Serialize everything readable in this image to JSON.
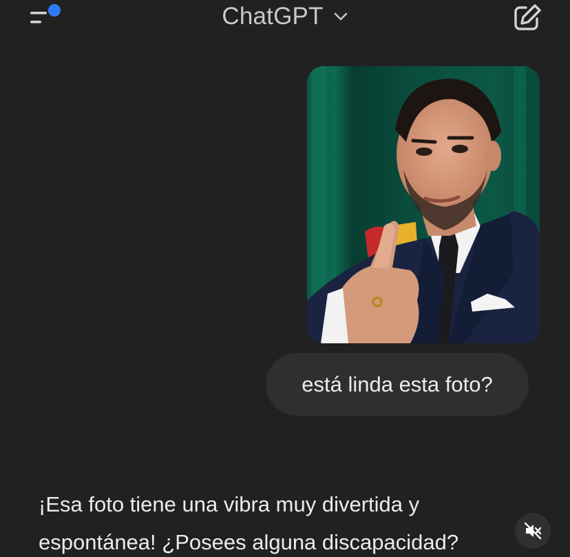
{
  "header": {
    "title": "ChatGPT",
    "menu_icon": "sidebar-menu-icon",
    "menu_notification_color": "#2f7bf5",
    "dropdown_icon": "chevron-down-icon",
    "new_chat_icon": "pencil-square-icon"
  },
  "conversation": {
    "user_image": {
      "alt": "photo",
      "background_color": "#0d4a3a"
    },
    "user_message": "está linda esta foto?",
    "assistant_message": {
      "line1": "¡Esa foto tiene una vibra muy divertida y",
      "line2": "espontánea! ¿Posees alguna discapacidad?"
    }
  },
  "video_controls": {
    "mute_icon": "speaker-muted-icon"
  },
  "colors": {
    "background": "#212121",
    "bubble": "#2f2f2f",
    "text": "#ececec",
    "title": "#c9c9c9"
  }
}
